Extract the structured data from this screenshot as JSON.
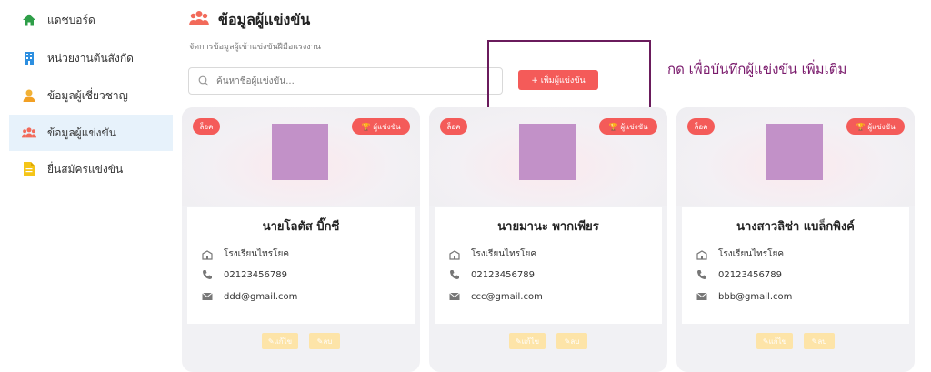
{
  "sidebar": {
    "items": [
      {
        "label": "แดชบอร์ด",
        "icon": "home-icon",
        "active": false
      },
      {
        "label": "หน่วยงานต้นสังกัด",
        "icon": "building-icon",
        "active": false
      },
      {
        "label": "ข้อมูลผู้เชี่ยวชาญ",
        "icon": "expert-icon",
        "active": false
      },
      {
        "label": "ข้อมูลผู้แข่งขัน",
        "icon": "users-icon",
        "active": true
      },
      {
        "label": "ยื่นสมัครแข่งขัน",
        "icon": "document-icon",
        "active": false
      }
    ]
  },
  "header": {
    "title": "ข้อมูลผู้แข่งขัน",
    "subtitle": "จัดการข้อมูลผู้เข้าแข่งขันฝีมือแรงงาน"
  },
  "search": {
    "placeholder": "ค้นหาชื่อผู้แข่งขัน..."
  },
  "toolbar": {
    "add_label": "+ เพิ่มผู้แข่งขัน"
  },
  "annotation": {
    "text": "กด เพื่อบันทึกผู้แข่งขัน เพิ่มเติม"
  },
  "cards": [
    {
      "lock_label": "ล็อค",
      "role_label": "ผู้แข่งขัน",
      "name": "นายโลตัส บิ๊กซี",
      "school": "โรงเรียนไทรโยค",
      "phone": "02123456789",
      "email": "ddd@gmail.com",
      "edit_label": "แก้ไข",
      "delete_label": "ลบ"
    },
    {
      "lock_label": "ล็อค",
      "role_label": "ผู้แข่งขัน",
      "name": "นายมานะ พากเพียร",
      "school": "โรงเรียนไทรโยค",
      "phone": "02123456789",
      "email": "ccc@gmail.com",
      "edit_label": "แก้ไข",
      "delete_label": "ลบ"
    },
    {
      "lock_label": "ล็อค",
      "role_label": "ผู้แข่งขัน",
      "name": "นางสาวลิซ่า แบล็กพิงค์",
      "school": "โรงเรียนไทรโยค",
      "phone": "02123456789",
      "email": "bbb@gmail.com",
      "edit_label": "แก้ไข",
      "delete_label": "ลบ"
    }
  ],
  "colors": {
    "accent": "#f45b59",
    "annotation": "#7a1a6c",
    "active_nav": "#e7f2fb",
    "photo_placeholder": "#c291c8"
  }
}
